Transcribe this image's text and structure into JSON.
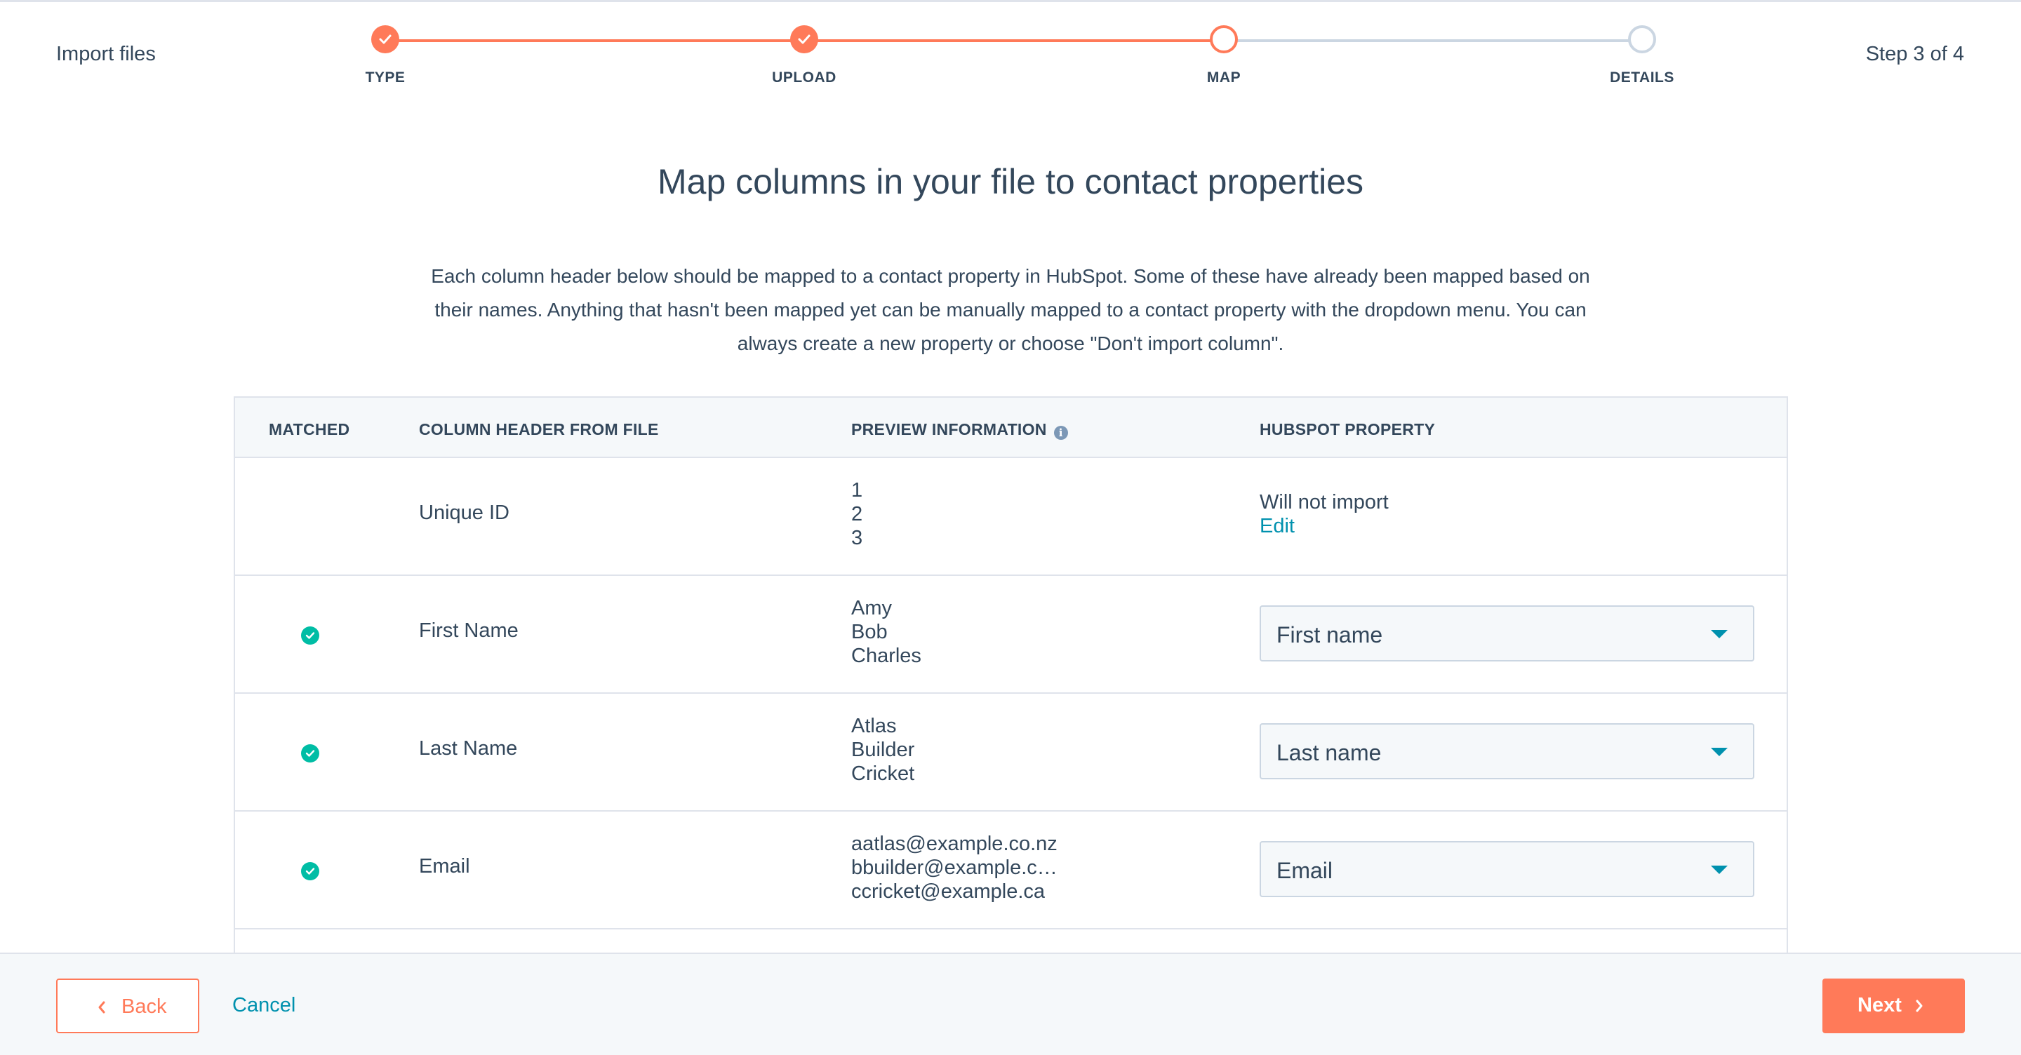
{
  "header": {
    "title": "Import files",
    "step_count": "Step 3 of 4",
    "steps": [
      {
        "label": "TYPE",
        "state": "done"
      },
      {
        "label": "UPLOAD",
        "state": "done"
      },
      {
        "label": "MAP",
        "state": "current"
      },
      {
        "label": "DETAILS",
        "state": "future"
      }
    ]
  },
  "main": {
    "title": "Map columns in your file to contact properties",
    "description": "Each column header below should be mapped to a contact property in HubSpot. Some of these have already been mapped based on their names. Anything that hasn't been mapped yet can be manually mapped to a contact property with the dropdown menu. You can always create a new property or choose \"Don't import column\"."
  },
  "table": {
    "headers": {
      "matched": "MATCHED",
      "column_header": "COLUMN HEADER FROM FILE",
      "preview": "PREVIEW INFORMATION",
      "property": "HUBSPOT PROPERTY"
    },
    "rows": [
      {
        "matched": false,
        "column": "Unique ID",
        "preview": [
          "1",
          "2",
          "3"
        ],
        "property_text": "Will not import",
        "edit_label": "Edit"
      },
      {
        "matched": true,
        "column": "First Name",
        "preview": [
          "Amy",
          "Bob",
          "Charles"
        ],
        "property": "First name"
      },
      {
        "matched": true,
        "column": "Last Name",
        "preview": [
          "Atlas",
          "Builder",
          "Cricket"
        ],
        "property": "Last name"
      },
      {
        "matched": true,
        "column": "Email",
        "preview": [
          "aatlas@example.co.nz",
          "bbuilder@example.c…",
          "ccricket@example.ca"
        ],
        "property": "Email"
      }
    ]
  },
  "footer": {
    "back_label": "Back",
    "cancel_label": "Cancel",
    "next_label": "Next"
  },
  "colors": {
    "accent": "#ff7a59",
    "link": "#0091ae",
    "success": "#00bda5",
    "text": "#33475b",
    "border": "#dfe3eb"
  },
  "icons": [
    "check-icon",
    "info-icon",
    "caret-down-icon",
    "chevron-left-icon",
    "chevron-right-icon"
  ]
}
